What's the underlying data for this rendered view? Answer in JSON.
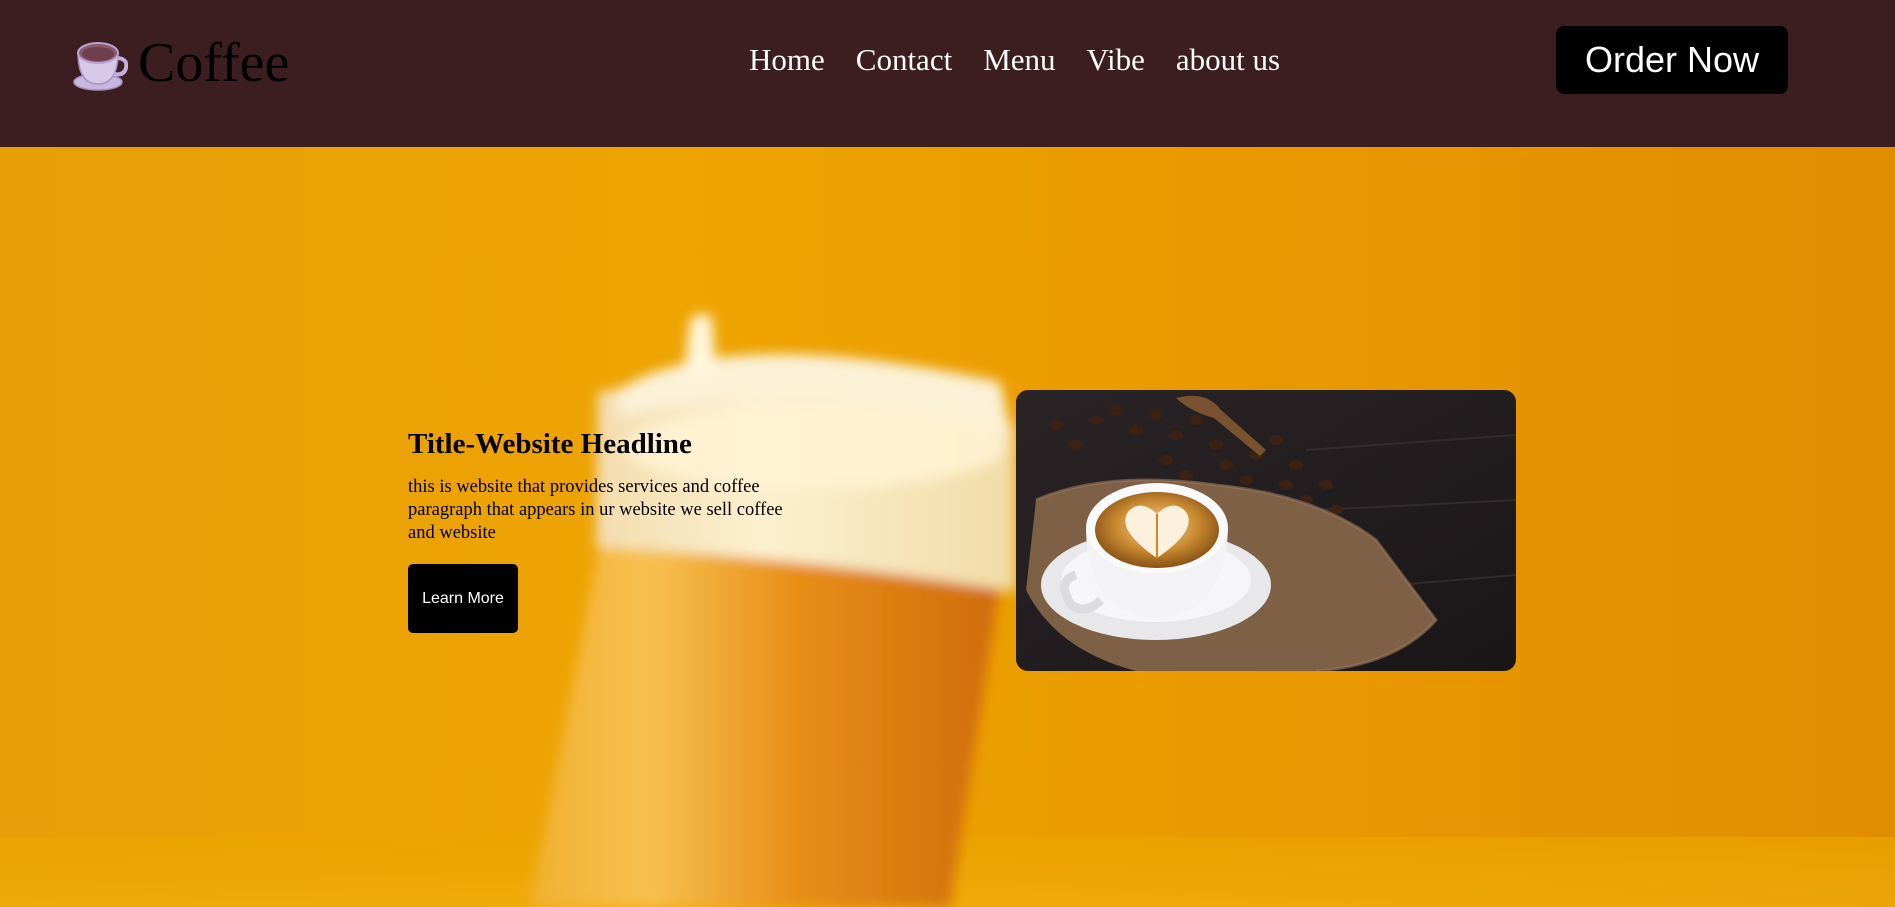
{
  "header": {
    "brand": "Coffee",
    "logo_icon": "coffee-cup-icon",
    "nav": [
      {
        "label": "Home"
      },
      {
        "label": "Contact"
      },
      {
        "label": "Menu"
      },
      {
        "label": "Vibe"
      },
      {
        "label": "about us"
      }
    ],
    "order_button": "Order Now"
  },
  "hero": {
    "headline": "Title-Website Headline",
    "paragraph": "this is website that provides services and coffee paragraph that appears in ur website we sell coffee and website",
    "button": "Learn More",
    "photo_icon": "latte-photo-icon",
    "background_icon": "takeaway-cup-image"
  },
  "colors": {
    "header_bg": "#3d1e20",
    "hero_bg": "#eba002",
    "button_bg": "#000000",
    "nav_text": "#ffffff"
  }
}
